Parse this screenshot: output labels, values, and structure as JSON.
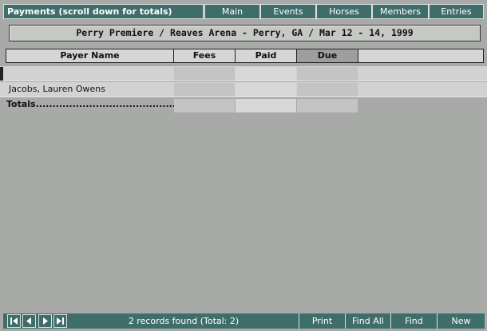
{
  "window": {
    "title": "Payments (scroll down for totals)"
  },
  "nav": [
    "Main",
    "Events",
    "Horses",
    "Members",
    "Entries"
  ],
  "event": {
    "header": "Perry Premiere / Reaves Arena - Perry, GA / Mar 12 - 14, 1999"
  },
  "table": {
    "columns": [
      "Payer Name",
      "Fees",
      "Paid",
      "Due"
    ],
    "rows": [
      {
        "name": "",
        "fees": "",
        "paid": "",
        "due": ""
      },
      {
        "name": "Jacobs, Lauren Owens",
        "fees": "",
        "paid": "",
        "due": ""
      }
    ],
    "totals_label": "Totals...............................................",
    "totals": {
      "fees": "",
      "paid": "",
      "due": ""
    }
  },
  "footer": {
    "status": "2 records found   (Total: 2)",
    "buttons": [
      "Print",
      "Find All",
      "Find",
      "New"
    ],
    "vcr": [
      "first-record-icon",
      "prev-record-icon",
      "next-record-icon",
      "last-record-icon"
    ]
  },
  "colors": {
    "accent": "#3f6d6a",
    "background": "#a8aaa8"
  }
}
